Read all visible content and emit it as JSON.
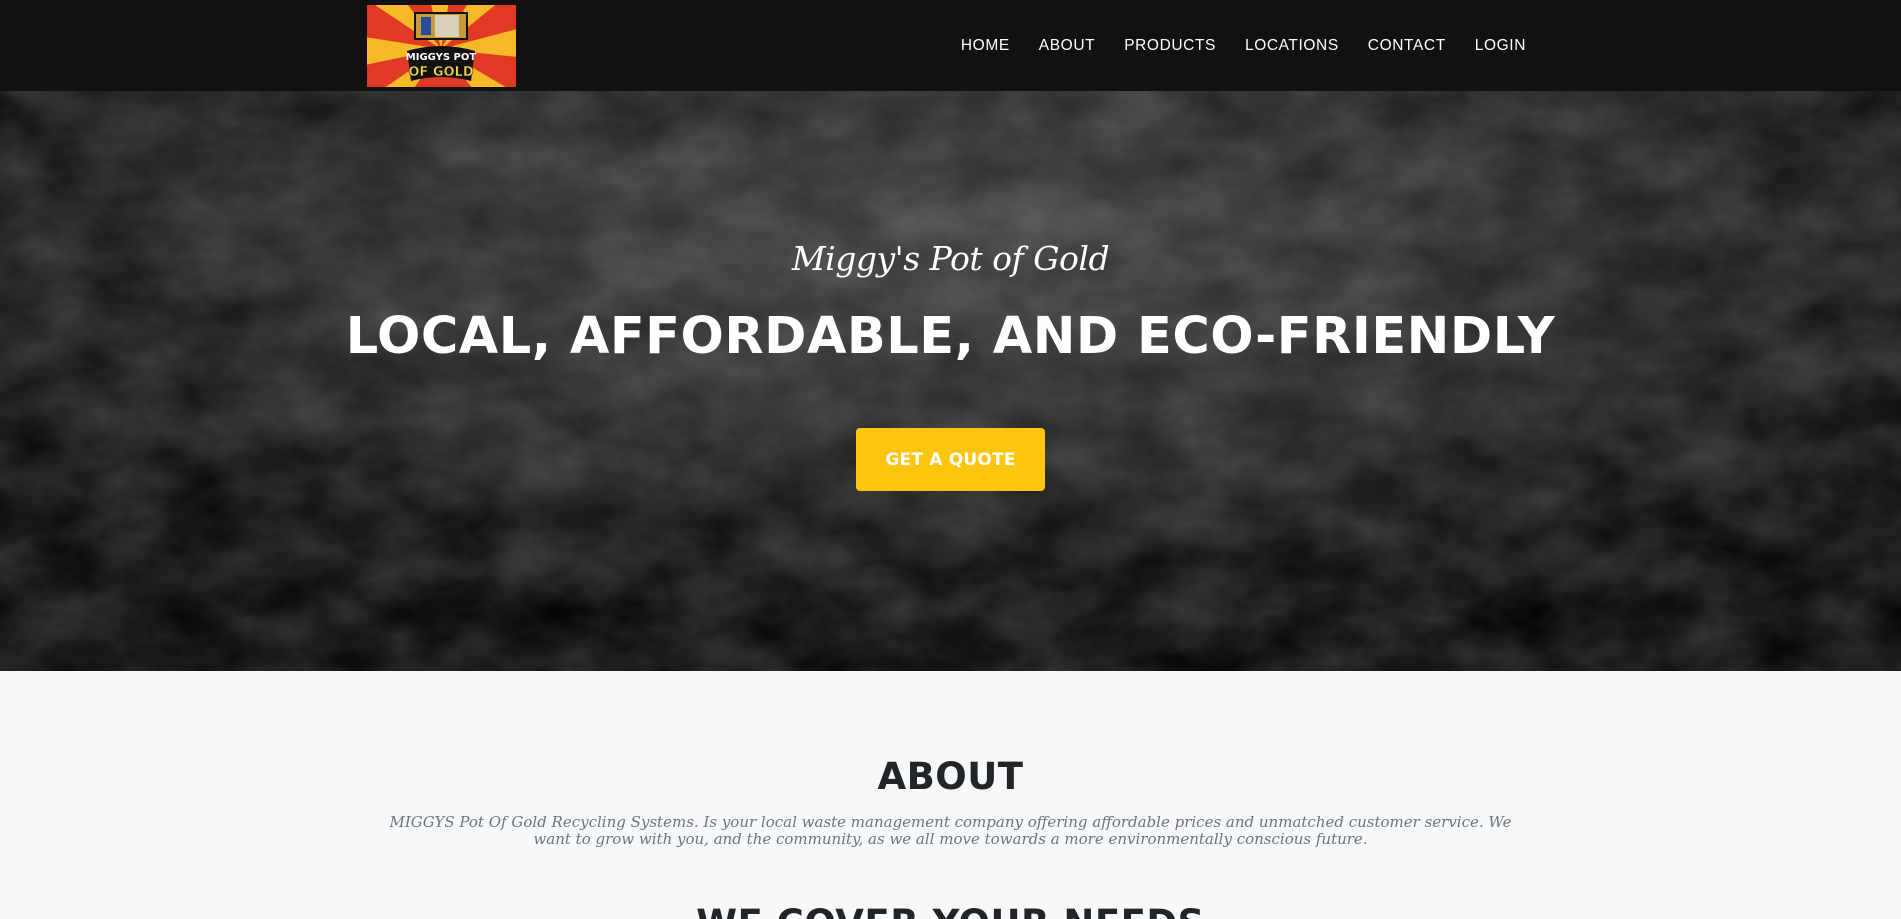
{
  "navbar": {
    "logo_lines": [
      "MIGGYS POT",
      "OF GOLD"
    ],
    "links": [
      "HOME",
      "ABOUT",
      "PRODUCTS",
      "LOCATIONS",
      "CONTACT",
      "LOGIN"
    ]
  },
  "hero": {
    "subtitle": "Miggy's Pot of Gold",
    "title": "LOCAL, AFFORDABLE, AND ECO-FRIENDLY",
    "cta_label": "GET A QUOTE"
  },
  "about": {
    "heading": "ABOUT",
    "text": "MIGGYS Pot Of Gold Recycling Systems. Is your local waste management company offering affordable prices and unmatched customer service. We want to grow with you, and the community, as we all move towards a more environmentally conscious future."
  },
  "services": {
    "heading": "WE COVER YOUR NEEDS"
  },
  "colors": {
    "navbar_bg": "#121011",
    "accent": "#fec50f",
    "logo_red": "#e13a24",
    "logo_yellow": "#f6b928"
  }
}
